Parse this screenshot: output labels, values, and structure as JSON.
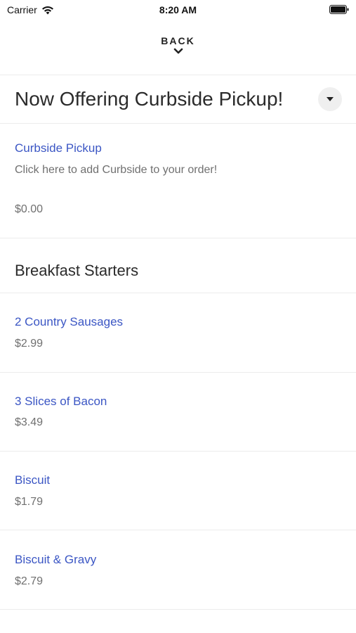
{
  "status_bar": {
    "carrier": "Carrier",
    "time": "8:20 AM",
    "icons": [
      "wifi-icon",
      "battery-icon"
    ]
  },
  "nav": {
    "back_label": "BACK",
    "back_icon": "chevron-down-icon"
  },
  "promo_section": {
    "title": "Now Offering Curbside Pickup!",
    "toggle_icon": "caret-down-icon",
    "item": {
      "name": "Curbside Pickup",
      "description": "Click here to add Curbside to your order!",
      "price": "$0.00"
    }
  },
  "breakfast_section": {
    "title": "Breakfast Starters",
    "items": [
      {
        "name": "2 Country Sausages",
        "price": "$2.99"
      },
      {
        "name": "3 Slices of Bacon",
        "price": "$3.49"
      },
      {
        "name": "Biscuit",
        "price": "$1.79"
      },
      {
        "name": "Biscuit & Gravy",
        "price": "$2.79"
      }
    ]
  },
  "colors": {
    "link": "#3b56c4",
    "text": "#2b2b2b",
    "muted": "#707070",
    "divider": "#ececec"
  }
}
